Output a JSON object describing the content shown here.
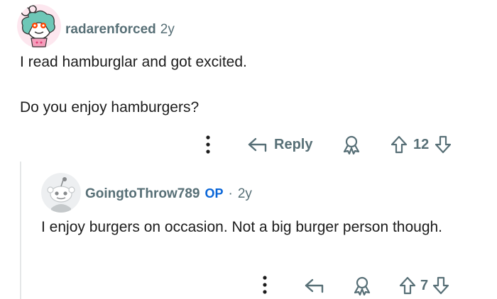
{
  "comment1": {
    "username": "radarenforced",
    "age": "2y",
    "lines": [
      "I read hamburglar and got excited.",
      "Do you enjoy hamburgers?"
    ],
    "actions": {
      "reply_label": "Reply",
      "score": "12"
    }
  },
  "comment2": {
    "username": "GoingtoThrow789",
    "op_badge": "OP",
    "separator": "·",
    "age": "2y",
    "text": "I enjoy burgers on occasion. Not a big burger person though.",
    "actions": {
      "score": "7"
    }
  },
  "icons": {
    "more": "more-vertical-icon",
    "reply": "reply-arrow-icon",
    "award": "award-icon",
    "upvote": "upvote-arrow-icon",
    "downvote": "downvote-arrow-icon"
  },
  "colors": {
    "meta": "#576f76",
    "op": "#0a66d8",
    "thread": "#e5e7e8"
  }
}
